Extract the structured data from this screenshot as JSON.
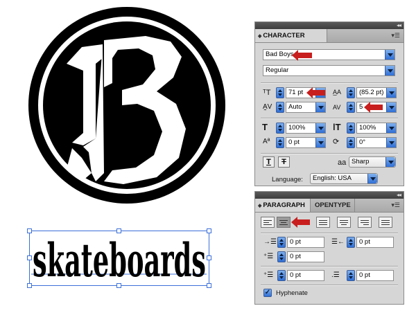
{
  "artwork": {
    "logo_letter": "B",
    "wordmark": "skateboards"
  },
  "character_panel": {
    "tab": "CHARACTER",
    "font_family": "Bad Boys",
    "font_style": "Regular",
    "font_size": "71 pt",
    "leading": "(85.2 pt)",
    "kerning": "Auto",
    "tracking": "5",
    "vertical_scale": "100%",
    "horizontal_scale": "100%",
    "baseline_shift": "0 pt",
    "rotation": "0°",
    "underline_label": "T",
    "strikethrough_label": "T",
    "antialias_icon_label": "aa",
    "antialias": "Sharp",
    "language_label": "Language:",
    "language": "English: USA"
  },
  "paragraph_panel": {
    "tabs": [
      "PARAGRAPH",
      "OPENTYPE"
    ],
    "left_indent": "0 pt",
    "right_indent": "0 pt",
    "first_line_indent": "0 pt",
    "space_before": "0 pt",
    "space_after": "0 pt",
    "hyphenate_label": "Hyphenate",
    "hyphenate_checked": true,
    "active_alignment": "align-center"
  },
  "colors": {
    "accent_blue": "#2f6fd5",
    "highlight_arrow": "#c81e1e",
    "selection_blue": "#3b6fd8"
  }
}
